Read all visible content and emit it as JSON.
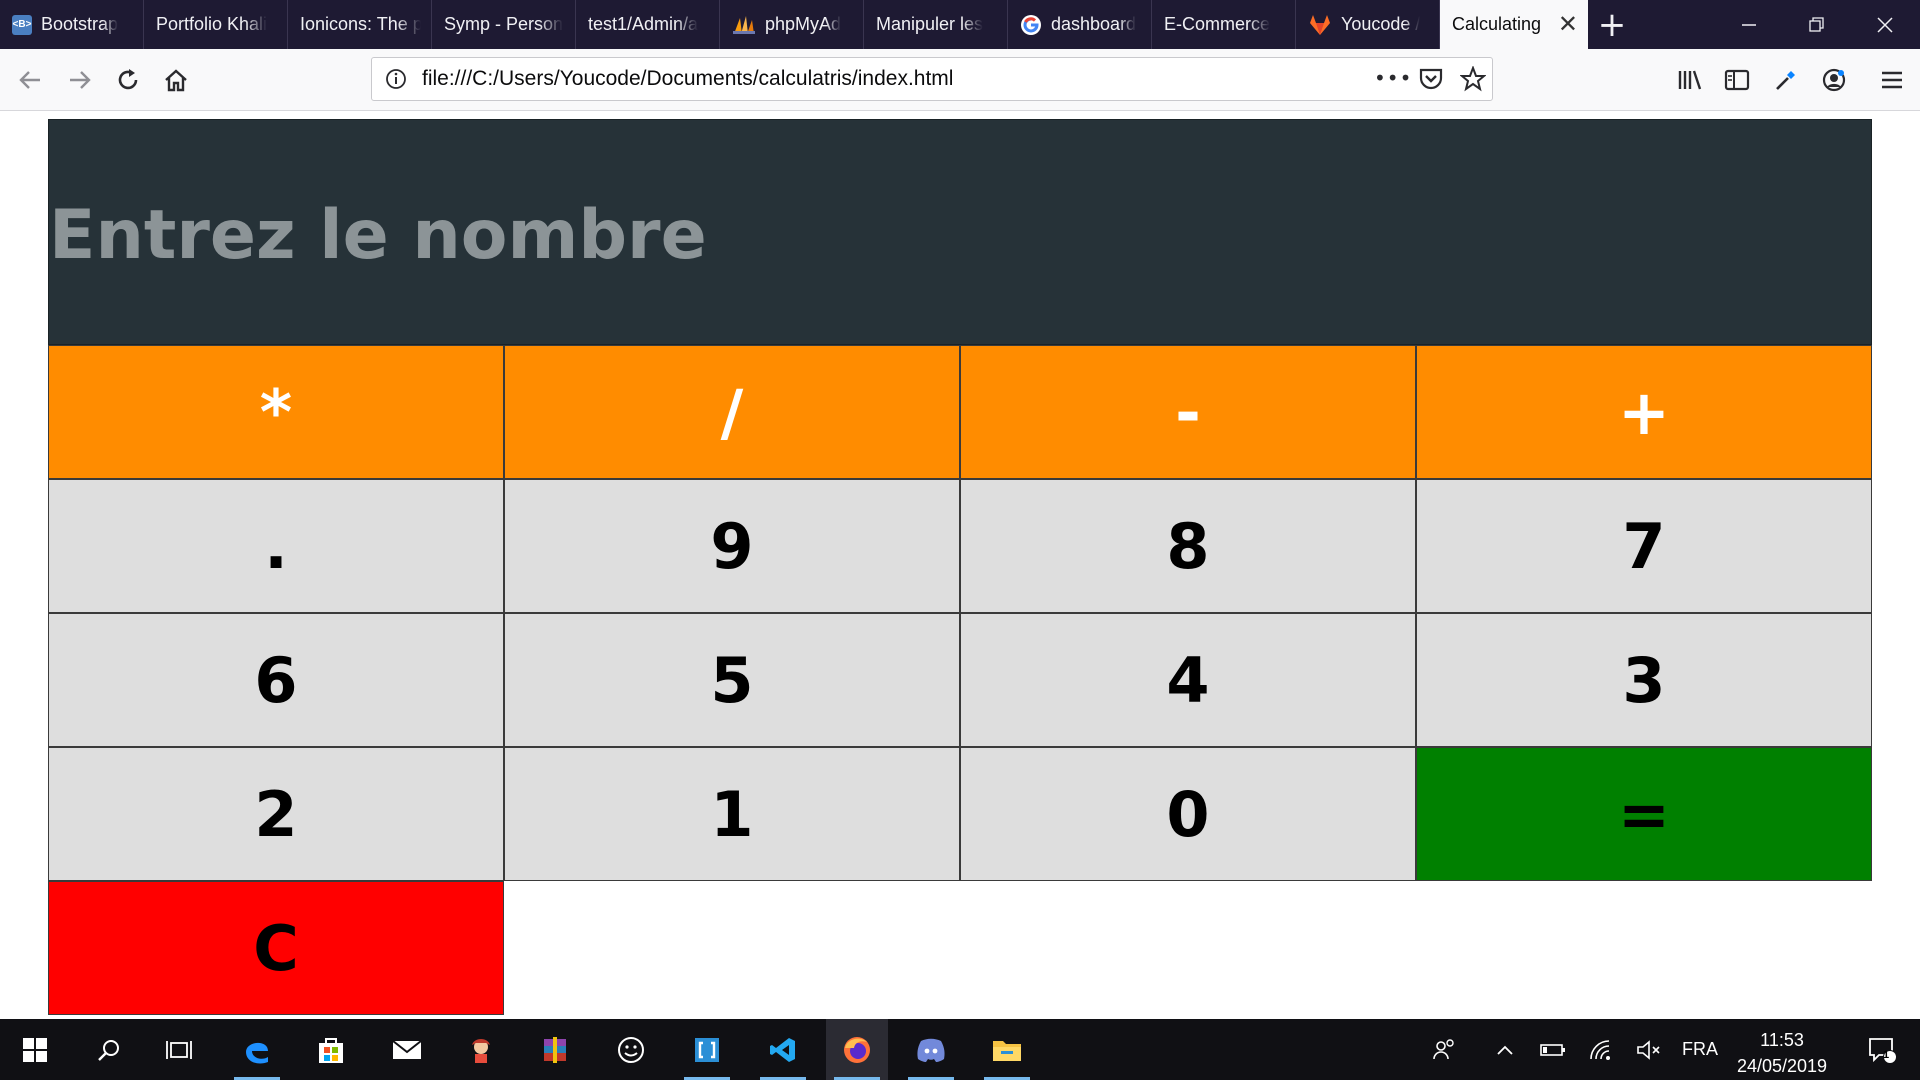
{
  "browser": {
    "tabs": [
      {
        "label": "Bootstrap",
        "icon": "bootstrap-favicon-icon",
        "color": "#563d7c"
      },
      {
        "label": "Portfolio Khali",
        "icon": "blank-favicon-icon"
      },
      {
        "label": "Ionicons: The p",
        "icon": "blank-favicon-icon"
      },
      {
        "label": "Symp - Person",
        "icon": "blank-favicon-icon"
      },
      {
        "label": "test1/Admin/a",
        "icon": "blank-favicon-icon"
      },
      {
        "label": "phpMyAd",
        "icon": "phpmyadmin-favicon-icon"
      },
      {
        "label": "Manipuler les",
        "icon": "blank-favicon-icon"
      },
      {
        "label": "dashboard",
        "icon": "google-favicon-icon"
      },
      {
        "label": "E-Commerce",
        "icon": "blank-favicon-icon"
      },
      {
        "label": "Youcode /",
        "icon": "gitlab-favicon-icon",
        "color": "#fc6d26"
      },
      {
        "label": "Calculating",
        "icon": "blank-favicon-icon",
        "active": true
      }
    ],
    "new_tab_symbol": "+",
    "url": "file:///C:/Users/Youcode/Documents/calculatris/index.html",
    "url_more_symbol": "•••"
  },
  "calculator": {
    "display_placeholder": "Entrez le nombre",
    "display_value": "",
    "operators": [
      "*",
      "/",
      "-",
      "+"
    ],
    "digits_row1": [
      ".",
      "9",
      "8",
      "7"
    ],
    "digits_row2": [
      "6",
      "5",
      "4",
      "3"
    ],
    "digits_row3": [
      "2",
      "1",
      "0"
    ],
    "equals": "=",
    "clear": "C",
    "colors": {
      "display_bg": "#263238",
      "operator_bg": "#ff8c00",
      "digit_bg": "#dedede",
      "equals_bg": "#008000",
      "clear_bg": "#ff0000"
    }
  },
  "taskbar": {
    "language": "FRA",
    "time": "11:53",
    "date": "24/05/2019",
    "notification_count": "1"
  }
}
